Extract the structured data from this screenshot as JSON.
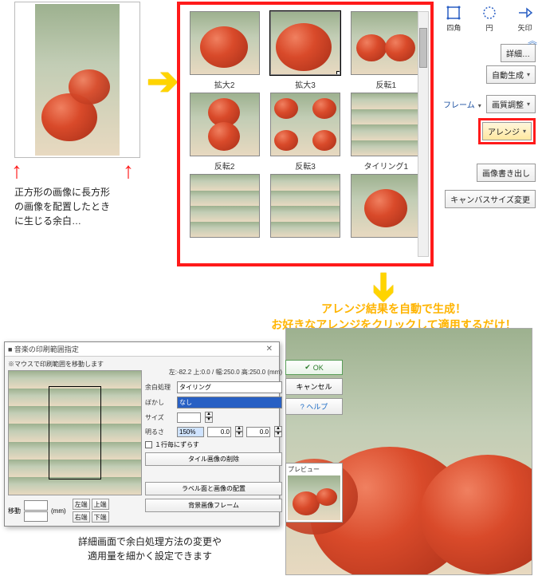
{
  "source_caption_l1": "正方形の画像に長方形",
  "source_caption_l2": "の画像を配置したとき",
  "source_caption_l3": "に生じる余白…",
  "grid": {
    "labels": [
      "拡大2",
      "拡大3",
      "反転1",
      "反転2",
      "反転3",
      "タイリング1"
    ]
  },
  "toolbar": {
    "shape_square": "四角",
    "shape_circle": "円",
    "shape_arrow": "矢印",
    "details": "詳細…",
    "autogen": "自動生成",
    "frame": "フレーム",
    "quality": "画質調整",
    "arrange": "アレンジ",
    "export": "画像書き出し",
    "canvas": "キャンバスサイズ変更"
  },
  "message_l1": "アレンジ結果を自動で生成！",
  "message_l2": "お好きなアレンジをクリックして適用するだけ！",
  "dialog": {
    "title": "■ 音楽の印刷範囲指定",
    "hint": "※マウスで印刷範囲を移動します",
    "coords": "左:-82.2 上:0.0 / 幅:250.0 高:250.0 (mm)",
    "ok": "OK",
    "cancel": "キャンセル",
    "help": "ヘルプ",
    "margin_label": "余白処理",
    "margin_value": "タイリング",
    "blur_label": "ぼかし",
    "blur_value": "なし",
    "size_label": "サイズ",
    "brightness_label": "明るさ",
    "brightness_value": "150%",
    "zero": "0.0",
    "wrap_check": "１行毎にずらす",
    "tile_reset": "タイル画像の削除",
    "labels_btn": "ラベル面と画像の配置",
    "frame_btn": "背景画像フレーム",
    "move": "移動",
    "mm": "(mm)",
    "left": "左端",
    "right": "右端",
    "top": "上端",
    "bottom": "下端",
    "preview": "プレビュー"
  },
  "bottom_caption_l1": "詳細画面で余白処理方法の変更や",
  "bottom_caption_l2": "適用量を細かく設定できます"
}
